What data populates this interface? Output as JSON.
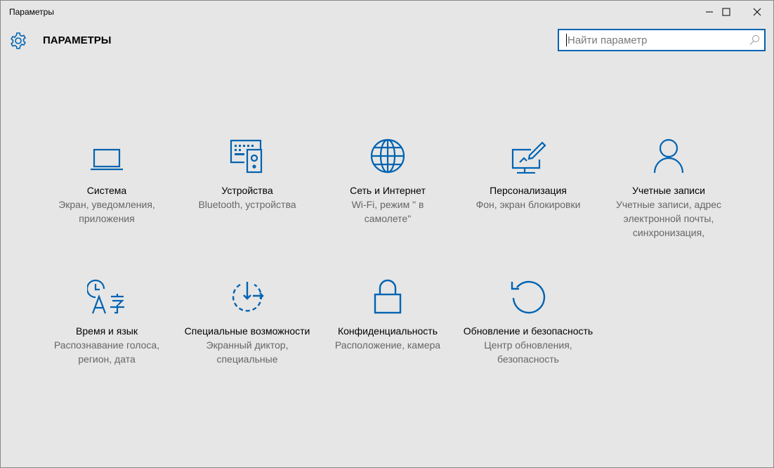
{
  "window": {
    "title": "Параметры"
  },
  "header": {
    "title": "ПАРАМЕТРЫ"
  },
  "search": {
    "placeholder": "Найти параметр"
  },
  "accent": "#0063b1",
  "tiles": [
    {
      "label": "Система",
      "sub": "Экран, уведомления, приложения",
      "icon": "laptop-icon"
    },
    {
      "label": "Устройства",
      "sub": "Bluetooth, устройства",
      "icon": "devices-icon"
    },
    {
      "label": "Сеть и Интернет",
      "sub": "Wi-Fi, режим \" в самолете\"",
      "icon": "globe-icon"
    },
    {
      "label": "Персонализация",
      "sub": "Фон, экран блокировки",
      "icon": "personalization-icon"
    },
    {
      "label": "Учетные записи",
      "sub": "Учетные записи, адрес электронной почты, синхронизация,",
      "icon": "person-icon"
    },
    {
      "label": "Время и язык",
      "sub": "Распознавание голоса, регион, дата",
      "icon": "time-language-icon"
    },
    {
      "label": "Специальные возможности",
      "sub": "Экранный диктор, специальные",
      "icon": "ease-of-access-icon"
    },
    {
      "label": "Конфиденциальность",
      "sub": "Расположение, камера",
      "icon": "lock-icon"
    },
    {
      "label": "Обновление и безопасность",
      "sub": "Центр обновления, безопасность",
      "icon": "update-icon"
    }
  ]
}
